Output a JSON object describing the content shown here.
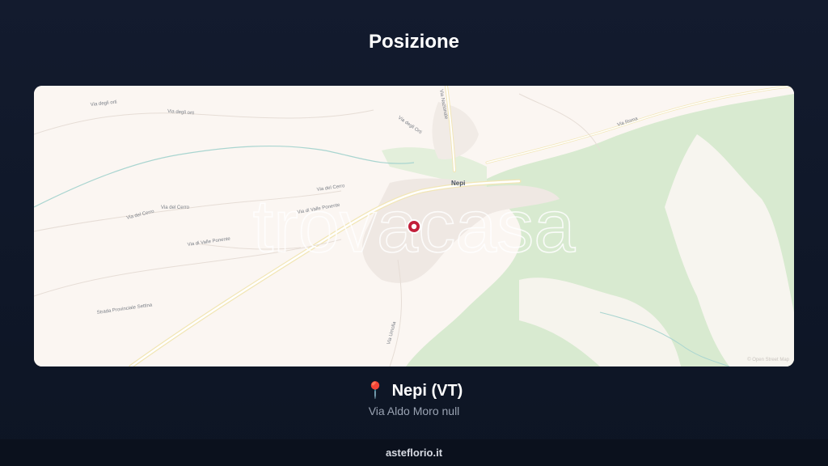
{
  "header": {
    "title": "Posizione"
  },
  "map": {
    "watermark": "trovacasa",
    "town_label": "Nepi",
    "road_labels": [
      "Via degli orti",
      "Via degli orti",
      "Via degli Orti",
      "Via Roma",
      "Via Nazionale",
      "Via del Cerro",
      "Via del Cerro",
      "Via del Cerro",
      "Via di Valle Ponente",
      "Via di Valle Ponente",
      "Strada Provinciale Settina",
      "Via Umolla"
    ],
    "attribution": "© Open Street Map",
    "colors": {
      "land": "#fbf6f2",
      "park": "#d8ead0",
      "marker": "#c21f3a"
    }
  },
  "location": {
    "pin_icon": "📍",
    "place": "Nepi (VT)",
    "address": "Via Aldo Moro null"
  },
  "footer": {
    "site": "asteflorio.it"
  }
}
